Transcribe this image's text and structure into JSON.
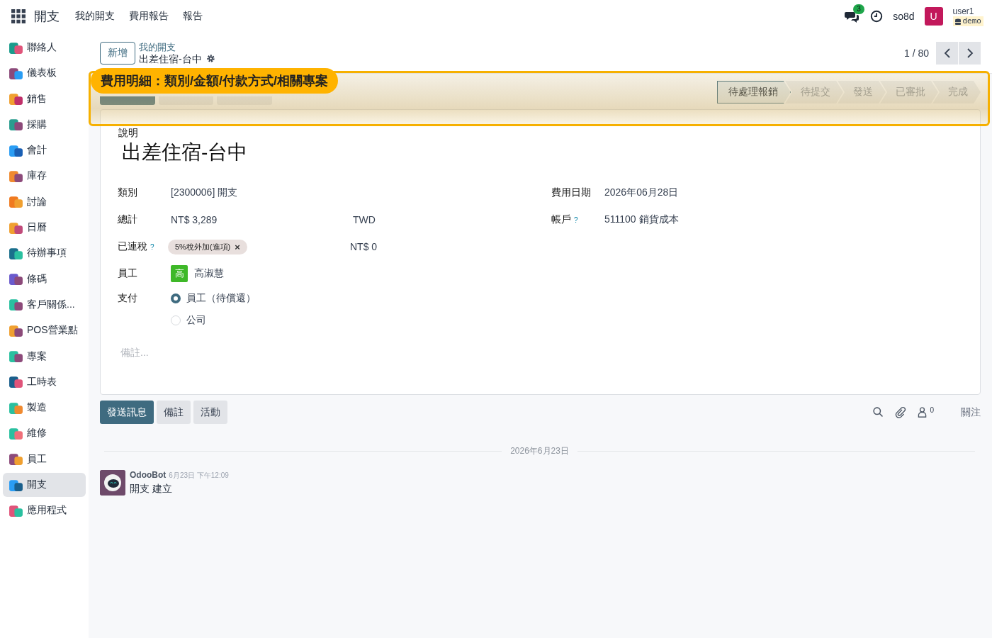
{
  "navbar": {
    "app_title": "開支",
    "menu": [
      "我的開支",
      "費用報告",
      "報告"
    ],
    "messages_badge": "3",
    "company": "so8d",
    "avatar_letter": "U",
    "user_name": "user1",
    "database": "demo"
  },
  "sidebar": {
    "items": [
      {
        "label": "聯絡人",
        "selected": false
      },
      {
        "label": "儀表板",
        "selected": false
      },
      {
        "label": "銷售",
        "selected": false
      },
      {
        "label": "採購",
        "selected": false
      },
      {
        "label": "會計",
        "selected": false
      },
      {
        "label": "庫存",
        "selected": false
      },
      {
        "label": "討論",
        "selected": false
      },
      {
        "label": "日曆",
        "selected": false
      },
      {
        "label": "待辦事項",
        "selected": false
      },
      {
        "label": "條碼",
        "selected": false
      },
      {
        "label": "客戶關係...",
        "selected": false
      },
      {
        "label": "POS營業點",
        "selected": false
      },
      {
        "label": "專案",
        "selected": false
      },
      {
        "label": "工時表",
        "selected": false
      },
      {
        "label": "製造",
        "selected": false
      },
      {
        "label": "維修",
        "selected": false
      },
      {
        "label": "員工",
        "selected": false
      },
      {
        "label": "開支",
        "selected": true
      },
      {
        "label": "應用程式",
        "selected": false
      }
    ]
  },
  "control_panel": {
    "new_button": "新增",
    "breadcrumb_parent": "我的開支",
    "breadcrumb_current": "出差住宿-台中",
    "pager": "1 / 80"
  },
  "callout": {
    "text": "費用明細：類別/金額/付款方式/相關專案"
  },
  "statusbar": {
    "stages": [
      {
        "label": "待處理報銷",
        "selected": true
      },
      {
        "label": "待提交",
        "selected": false
      },
      {
        "label": "發送",
        "selected": false
      },
      {
        "label": "已審批",
        "selected": false
      },
      {
        "label": "完成",
        "selected": false
      }
    ]
  },
  "form": {
    "description_label": "說明",
    "title": "出差住宿-台中",
    "category_label": "類別",
    "category": "[2300006] 開支",
    "date_label": "費用日期",
    "date": "2026年06月28日",
    "total_label": "總計",
    "total": "NT$ 3,289",
    "currency": "TWD",
    "account_label": "帳戶",
    "account_help": "?",
    "account": "511100 銷貨成本",
    "tax_label": "已連稅",
    "tax_help": "?",
    "tax_tag": "5%稅外加(進項)",
    "tax_tag_remove": "×",
    "tax_amount": "NT$ 0",
    "employee_label": "員工",
    "employee_initial": "高",
    "employee": "高淑慧",
    "payment_label": "支付",
    "payment_options": [
      {
        "label": "員工（待償還）",
        "selected": true
      },
      {
        "label": "公司",
        "selected": false
      }
    ],
    "notes_placeholder": "備註..."
  },
  "chatter": {
    "buttons": [
      {
        "label": "發送訊息",
        "selected": true
      },
      {
        "label": "備註",
        "selected": false
      },
      {
        "label": "活動",
        "selected": false
      }
    ],
    "followers_count": "0",
    "follow": "關注",
    "date_separator": "2026年6月23日",
    "messages": [
      {
        "author": "OdooBot",
        "time": "6月23日 下午12:09",
        "body": "開支 建立"
      }
    ]
  }
}
